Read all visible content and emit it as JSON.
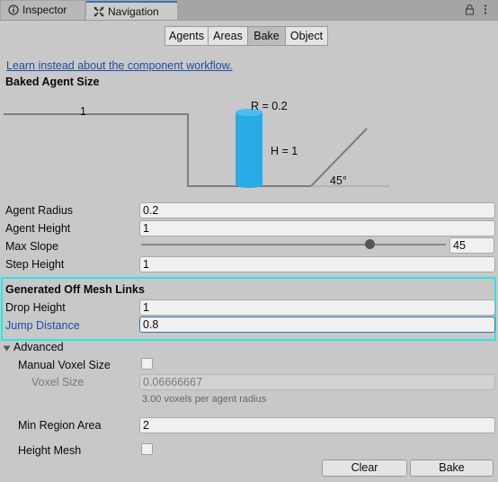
{
  "tabs": [
    {
      "label": "Inspector",
      "active": false,
      "icon": "info-icon"
    },
    {
      "label": "Navigation",
      "active": true,
      "icon": "navigation-icon"
    }
  ],
  "window_controls": [
    "lock-icon",
    "more-menu-icon"
  ],
  "toolbar": {
    "buttons": [
      {
        "label": "Agents",
        "selected": false
      },
      {
        "label": "Areas",
        "selected": false
      },
      {
        "label": "Bake",
        "selected": true
      },
      {
        "label": "Object",
        "selected": false
      }
    ]
  },
  "link": "Learn instead about the component workflow.",
  "baked_agent_size": {
    "title": "Baked Agent Size",
    "diagram": {
      "step_label": "1",
      "radius_label": "R = 0.2",
      "height_label": "H = 1",
      "slope_label": "45°"
    }
  },
  "agent_fields": [
    {
      "label": "Agent Radius",
      "value": "0.2"
    },
    {
      "label": "Agent Height",
      "value": "1"
    },
    {
      "label": "Max Slope",
      "value": "45",
      "slider_fraction": 0.75
    },
    {
      "label": "Step Height",
      "value": "1"
    }
  ],
  "off_mesh_links": {
    "title": "Generated Off Mesh Links",
    "drop_height": {
      "label": "Drop Height",
      "value": "1"
    },
    "jump_distance": {
      "label": "Jump Distance",
      "value": "0.8"
    }
  },
  "advanced": {
    "title": "Advanced",
    "manual_voxel_size": {
      "label": "Manual Voxel Size",
      "checked": false
    },
    "voxel_size": {
      "label": "Voxel Size",
      "value": "0.06666667",
      "hint": "3.00 voxels per agent radius"
    },
    "min_region_area": {
      "label": "Min Region Area",
      "value": "2"
    },
    "height_mesh": {
      "label": "Height Mesh",
      "checked": false
    }
  },
  "actions": {
    "clear": "Clear",
    "bake": "Bake"
  },
  "colors": {
    "cylinder": "#29a9e6",
    "focus_outline": "#2fe4e4",
    "link": "#1f4ea0",
    "accent": "#3a72b0"
  }
}
